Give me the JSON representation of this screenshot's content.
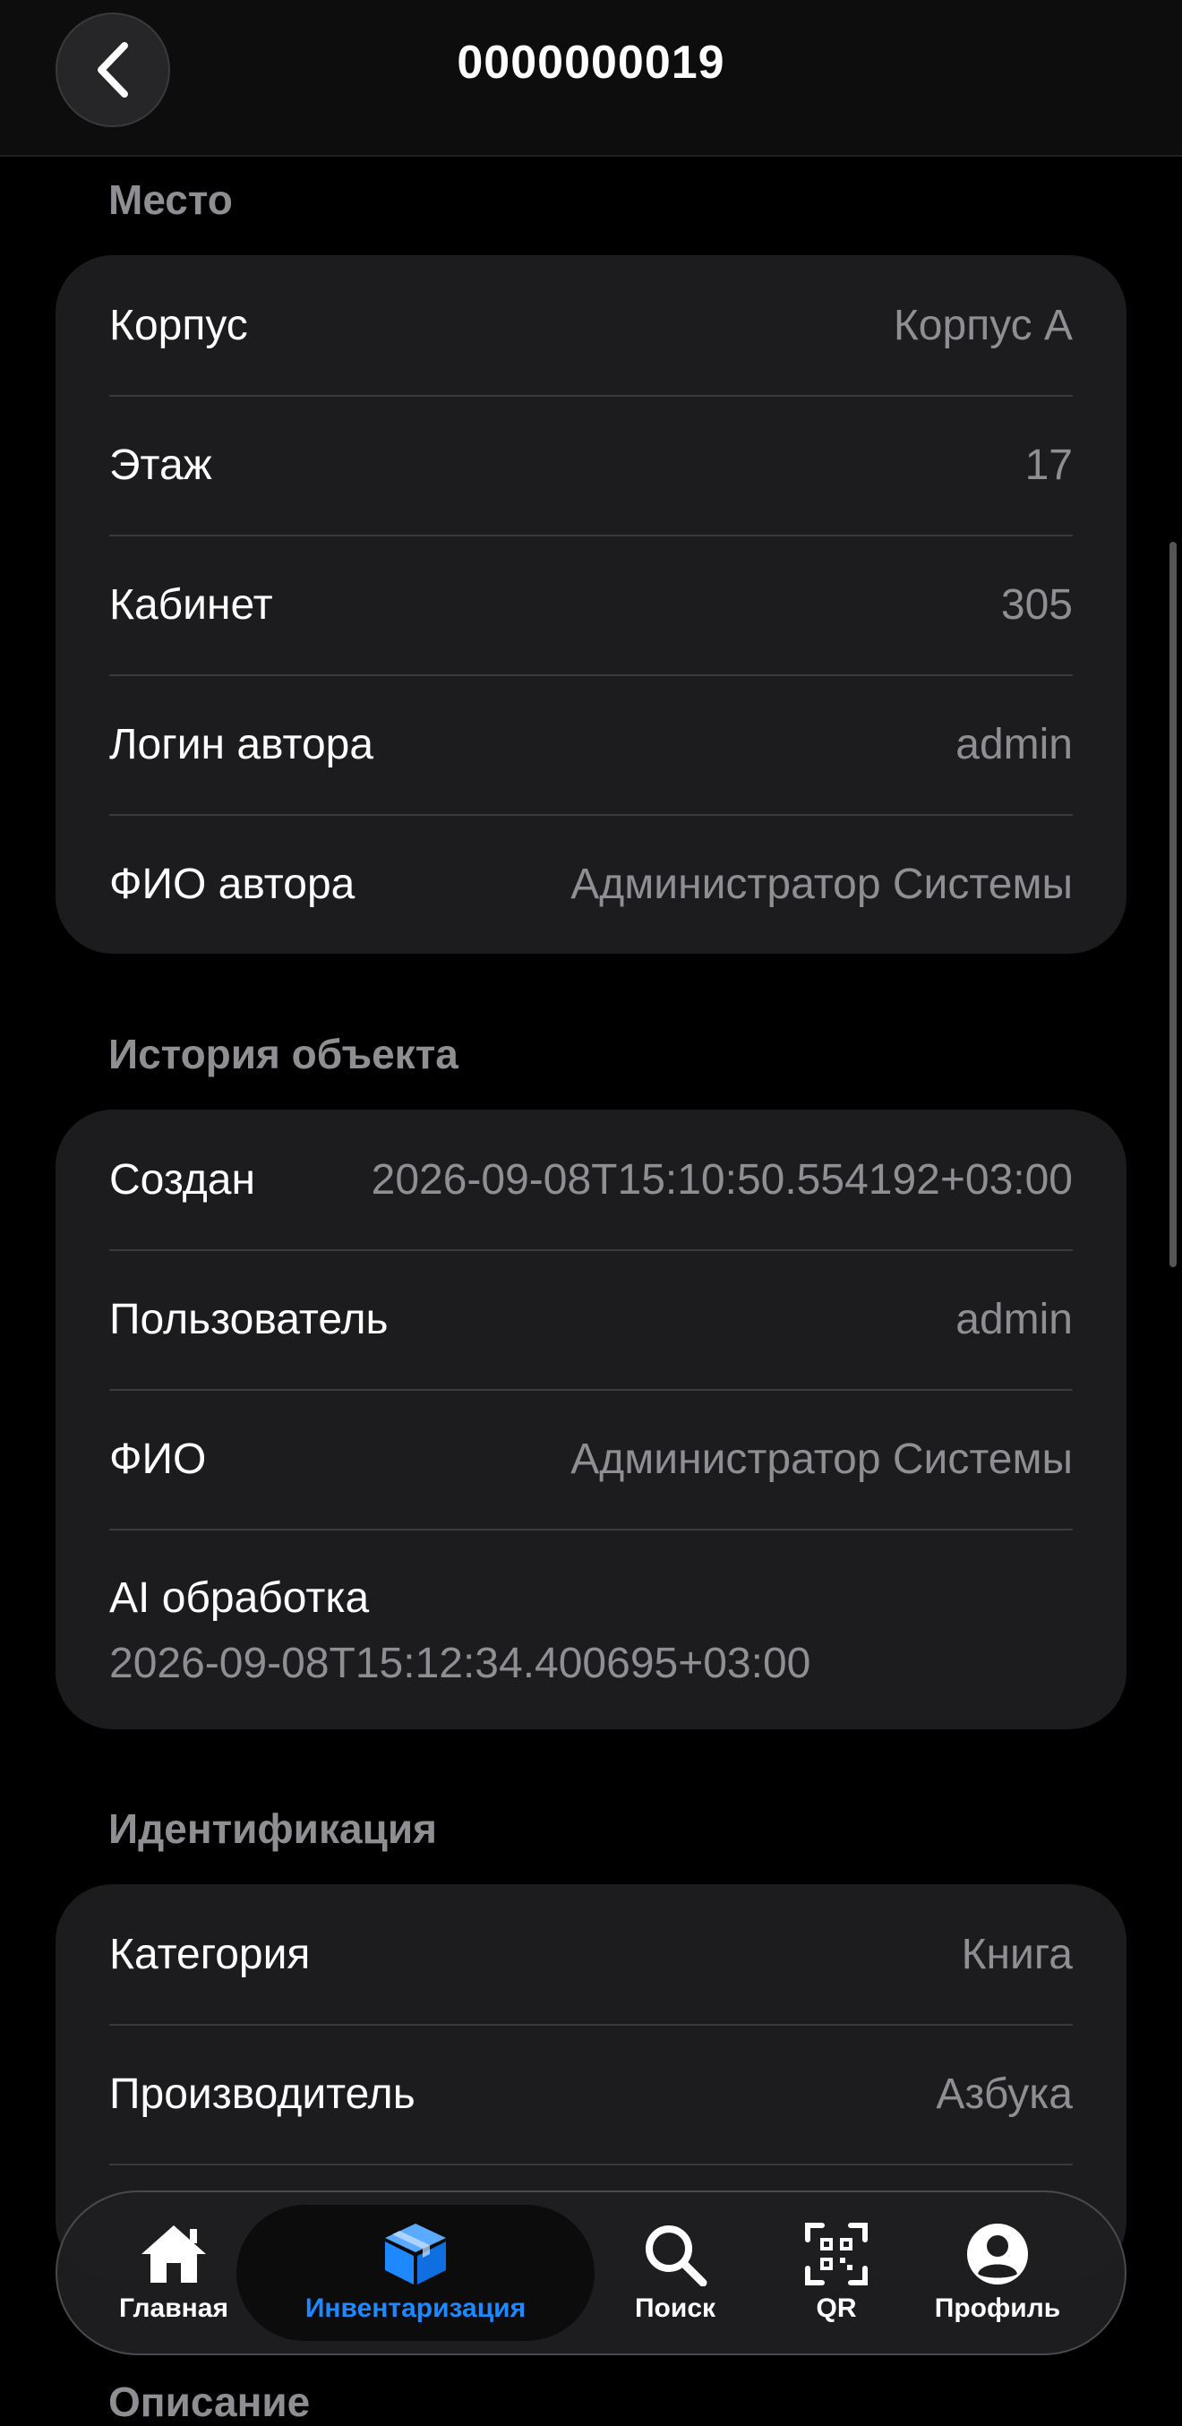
{
  "header": {
    "title": "0000000019"
  },
  "sections": {
    "place": {
      "title": "Место",
      "rows": [
        {
          "label": "Корпус",
          "value": "Корпус А"
        },
        {
          "label": "Этаж",
          "value": "17"
        },
        {
          "label": "Кабинет",
          "value": "305"
        },
        {
          "label": "Логин автора",
          "value": "admin"
        },
        {
          "label": "ФИО автора",
          "value": "Администратор Системы"
        }
      ]
    },
    "history": {
      "title": "История объекта",
      "rows": [
        {
          "label": "Создан",
          "value": "2026-09-08T15:10:50.554192+03:00"
        },
        {
          "label": "Пользователь",
          "value": "admin"
        },
        {
          "label": "ФИО",
          "value": "Администратор Системы"
        },
        {
          "label": "AI обработка",
          "value": "2026-09-08T15:12:34.400695+03:00"
        }
      ]
    },
    "identification": {
      "title": "Идентификация",
      "rows": [
        {
          "label": "Категория",
          "value": "Книга"
        },
        {
          "label": "Производитель",
          "value": "Азбука"
        }
      ]
    },
    "description": {
      "title": "Описание"
    }
  },
  "tabbar": {
    "items": [
      {
        "label": "Главная",
        "icon": "home-icon"
      },
      {
        "label": "Инвентаризация",
        "icon": "box-icon",
        "active": true
      },
      {
        "label": "Поиск",
        "icon": "search-icon"
      },
      {
        "label": "QR",
        "icon": "qr-icon"
      },
      {
        "label": "Профиль",
        "icon": "profile-icon"
      }
    ]
  },
  "colors": {
    "accent": "#1e88ff",
    "card": "#1c1c1e",
    "secondary_text": "#8e8e93"
  }
}
